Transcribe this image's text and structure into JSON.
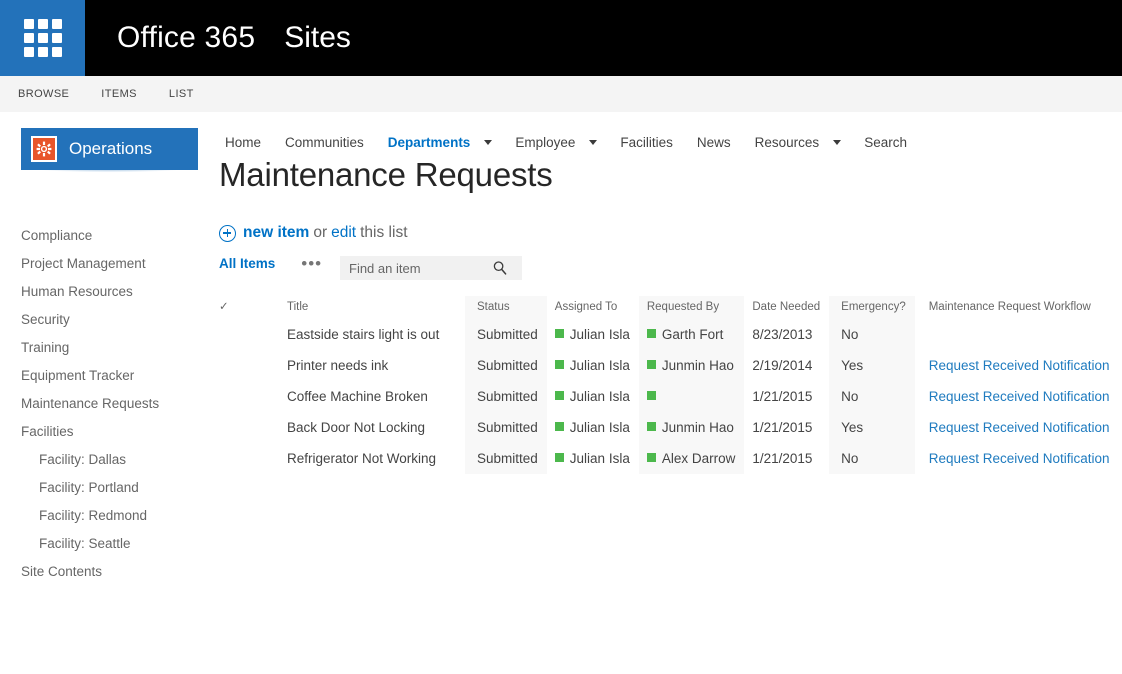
{
  "suite": {
    "waffle_icon": "app-launcher-waffle-icon",
    "brand": "Office 365",
    "site_label": "Sites"
  },
  "ribbon": {
    "tabs": [
      {
        "label": "BROWSE"
      },
      {
        "label": "ITEMS"
      },
      {
        "label": "LIST"
      }
    ]
  },
  "site_logo": {
    "icon": "gear-icon",
    "label": "Operations",
    "tile_color": "#e8552a",
    "banner_color": "#2372ba"
  },
  "topnav": {
    "items": [
      {
        "label": "Home",
        "has_caret": false,
        "selected": false
      },
      {
        "label": "Communities",
        "has_caret": false,
        "selected": false
      },
      {
        "label": "Departments",
        "has_caret": true,
        "selected": true
      },
      {
        "label": "Employee",
        "has_caret": true,
        "selected": false
      },
      {
        "label": "Facilities",
        "has_caret": false,
        "selected": false
      },
      {
        "label": "News",
        "has_caret": false,
        "selected": false
      },
      {
        "label": "Resources",
        "has_caret": true,
        "selected": false
      },
      {
        "label": "Search",
        "has_caret": false,
        "selected": false
      }
    ]
  },
  "leftnav": {
    "items": [
      {
        "label": "Compliance",
        "sub": false
      },
      {
        "label": "Project Management",
        "sub": false
      },
      {
        "label": "Human Resources",
        "sub": false
      },
      {
        "label": "Security",
        "sub": false
      },
      {
        "label": "Training",
        "sub": false
      },
      {
        "label": "Equipment Tracker",
        "sub": false
      },
      {
        "label": "Maintenance Requests",
        "sub": false
      },
      {
        "label": "Facilities",
        "sub": false
      },
      {
        "label": "Facility: Dallas",
        "sub": true
      },
      {
        "label": "Facility: Portland",
        "sub": true
      },
      {
        "label": "Facility: Redmond",
        "sub": true
      },
      {
        "label": "Facility: Seattle",
        "sub": true
      },
      {
        "label": "Site Contents",
        "sub": false
      }
    ]
  },
  "page": {
    "title": "Maintenance Requests",
    "new_item_label": "new item",
    "or_label": "or",
    "edit_label": "edit",
    "this_list_label": "this list"
  },
  "toolbar": {
    "view_name": "All Items",
    "ellipsis": "•••",
    "search_placeholder": "Find an item",
    "search_value": "",
    "search_icon": "magnifier-icon"
  },
  "list": {
    "select_all_icon": "checkmark-icon",
    "columns": [
      {
        "key": "title",
        "label": "Title",
        "shaded": false
      },
      {
        "key": "status",
        "label": "Status",
        "shaded": true
      },
      {
        "key": "assigned_to",
        "label": "Assigned To",
        "shaded": false
      },
      {
        "key": "requested_by",
        "label": "Requested By",
        "shaded": true
      },
      {
        "key": "date_needed",
        "label": "Date Needed",
        "shaded": false
      },
      {
        "key": "emergency",
        "label": "Emergency?",
        "shaded": true
      },
      {
        "key": "workflow",
        "label": "Maintenance Request Workflow",
        "shaded": false
      }
    ],
    "presence_color": "#4cb84c",
    "rows": [
      {
        "title": "Eastside stairs light is out",
        "status": "Submitted",
        "assigned_to": "Julian Isla",
        "requested_by": "Garth Fort",
        "date_needed": "8/23/2013",
        "emergency": "No",
        "workflow": ""
      },
      {
        "title": "Printer needs ink",
        "status": "Submitted",
        "assigned_to": "Julian Isla",
        "requested_by": "Junmin Hao",
        "date_needed": "2/19/2014",
        "emergency": "Yes",
        "workflow": "Request Received Notification"
      },
      {
        "title": "Coffee Machine Broken",
        "status": "Submitted",
        "assigned_to": "Julian Isla",
        "requested_by": "",
        "date_needed": "1/21/2015",
        "emergency": "No",
        "workflow": "Request Received Notification"
      },
      {
        "title": "Back Door Not Locking",
        "status": "Submitted",
        "assigned_to": "Julian Isla",
        "requested_by": "Junmin Hao",
        "date_needed": "1/21/2015",
        "emergency": "Yes",
        "workflow": "Request Received Notification"
      },
      {
        "title": "Refrigerator Not Working",
        "status": "Submitted",
        "assigned_to": "Julian Isla",
        "requested_by": "Alex Darrow",
        "date_needed": "1/21/2015",
        "emergency": "No",
        "workflow": "Request Received Notification"
      }
    ]
  }
}
